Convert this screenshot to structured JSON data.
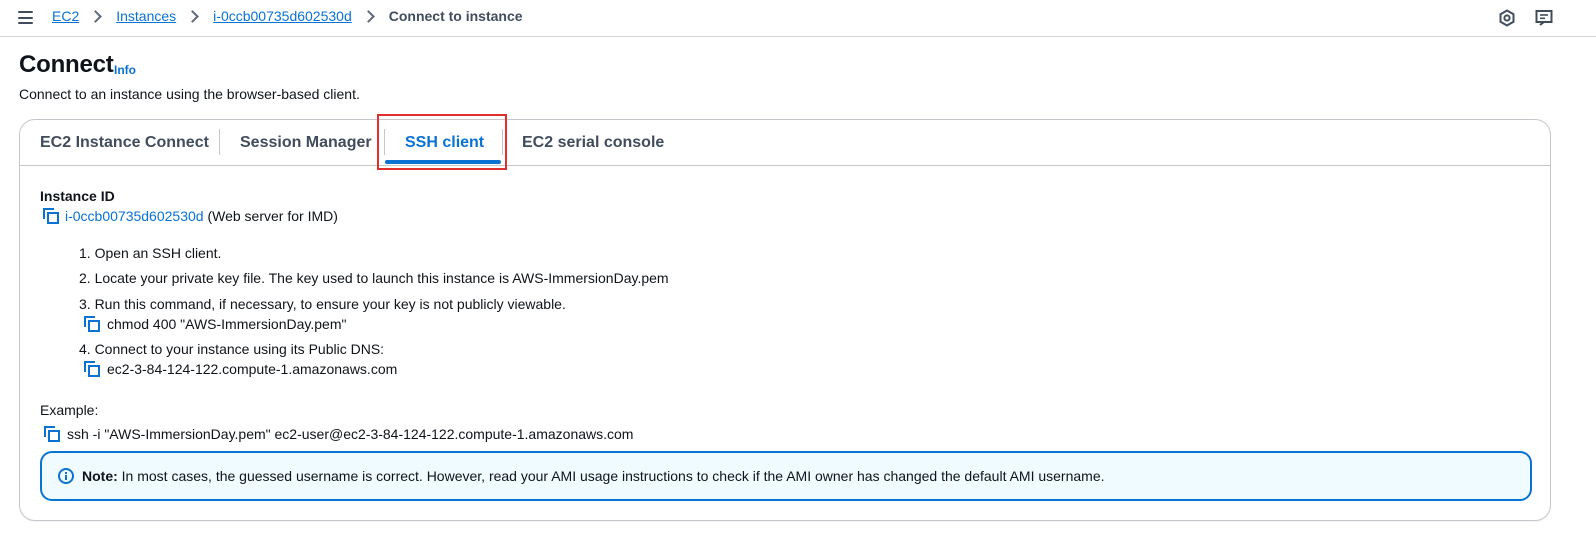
{
  "breadcrumb": {
    "items": [
      "EC2",
      "Instances",
      "i-0ccb00735d602530d"
    ],
    "current": "Connect to instance"
  },
  "header": {
    "title": "Connect",
    "info": "Info",
    "description": "Connect to an instance using the browser-based client."
  },
  "tabs": [
    {
      "label": "EC2 Instance Connect"
    },
    {
      "label": "Session Manager"
    },
    {
      "label": "SSH client"
    },
    {
      "label": "EC2 serial console"
    }
  ],
  "instance": {
    "label": "Instance ID",
    "id": "i-0ccb00735d602530d",
    "name": "(Web server for IMD)"
  },
  "steps": [
    "1. Open an SSH client.",
    "2. Locate your private key file. The key used to launch this instance is AWS-ImmersionDay.pem",
    "3. Run this command, if necessary, to ensure your key is not publicly viewable.",
    "4. Connect to your instance using its Public DNS:"
  ],
  "commands": {
    "chmod": "chmod 400 \"AWS-ImmersionDay.pem\"",
    "dns": "ec2-3-84-124-122.compute-1.amazonaws.com"
  },
  "example": {
    "label": "Example:",
    "command": "ssh -i \"AWS-ImmersionDay.pem\" ec2-user@ec2-3-84-124-122.compute-1.amazonaws.com"
  },
  "note": {
    "bold": "Note:",
    "text": " In most cases, the guessed username is correct. However, read your AMI usage instructions to check if the AMI owner has changed the default AMI username."
  },
  "colors": {
    "accent": "#0972d3",
    "highlight": "#e0302d",
    "note_bg": "#f0fbff"
  },
  "icons": [
    "menu-icon",
    "settings-icon",
    "feedback-icon",
    "copy-icon",
    "info-icon"
  ]
}
